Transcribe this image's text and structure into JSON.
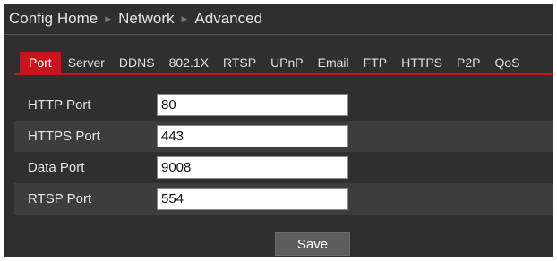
{
  "breadcrumb": {
    "items": [
      "Config Home",
      "Network",
      "Advanced"
    ],
    "separator": "▶"
  },
  "tabs": {
    "active": "Port",
    "items": [
      {
        "label": "Port"
      },
      {
        "label": "Server"
      },
      {
        "label": "DDNS"
      },
      {
        "label": "802.1X"
      },
      {
        "label": "RTSP"
      },
      {
        "label": "UPnP"
      },
      {
        "label": "Email"
      },
      {
        "label": "FTP"
      },
      {
        "label": "HTTPS"
      },
      {
        "label": "P2P"
      },
      {
        "label": "QoS"
      }
    ]
  },
  "form": {
    "fields": [
      {
        "label": "HTTP Port",
        "value": "80"
      },
      {
        "label": "HTTPS Port",
        "value": "443"
      },
      {
        "label": "Data Port",
        "value": "9008"
      },
      {
        "label": "RTSP Port",
        "value": "554"
      }
    ]
  },
  "actions": {
    "save_label": "Save"
  },
  "colors": {
    "background": "#2f2f2f",
    "row_alt": "#3d3d3d",
    "accent": "#c4161c",
    "save_button": "#5c5c5c"
  }
}
